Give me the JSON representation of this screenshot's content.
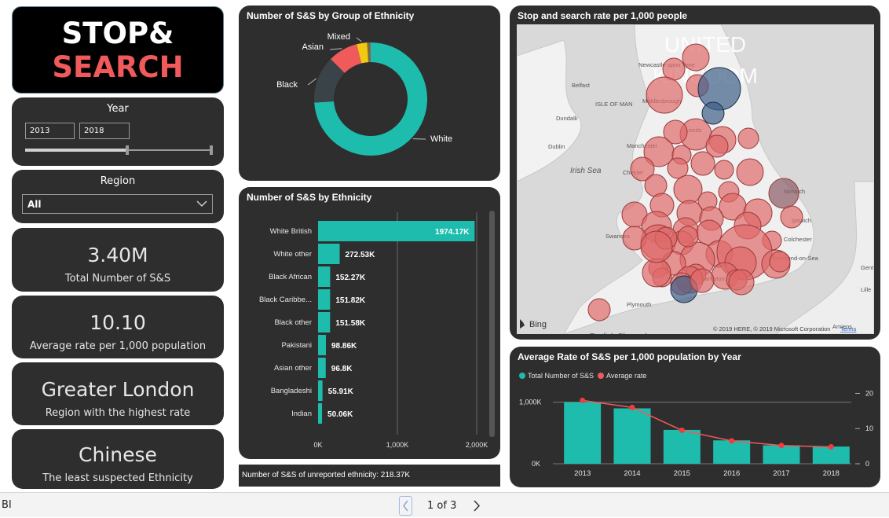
{
  "logo": {
    "line1": "STOP&",
    "line2": "SEARCH"
  },
  "year_slicer": {
    "title": "Year",
    "from": "2013",
    "to": "2018"
  },
  "region_slicer": {
    "title": "Region",
    "selected": "All"
  },
  "kpis": [
    {
      "value": "3.40M",
      "label": "Total Number of S&S"
    },
    {
      "value": "10.10",
      "label": "Average rate per 1,000 population"
    },
    {
      "value": "Greater London",
      "label": "Region with the highest rate"
    },
    {
      "value": "Chinese",
      "label": "The least suspected Ethnicity"
    }
  ],
  "donut": {
    "title": "Number of S&S by Group of Ethnicity",
    "chart_data": {
      "type": "pie",
      "categories": [
        "White",
        "Black",
        "Asian",
        "Mixed",
        "Other"
      ],
      "values": [
        74,
        13.5,
        8.5,
        3,
        1
      ],
      "colors": [
        "#1ebcad",
        "#3a4448",
        "#f05a5a",
        "#f2c811",
        "#7a6a4a"
      ],
      "labels": [
        "White",
        "Black",
        "Asian",
        "Mixed"
      ]
    }
  },
  "bars": {
    "title": "Number of S&S by Ethnicity",
    "chart_data": {
      "type": "bar",
      "orientation": "horizontal",
      "categories": [
        "White British",
        "White other",
        "Black African",
        "Black Caribbe...",
        "Black other",
        "Pakistani",
        "Asian other",
        "Bangladeshi",
        "Indian"
      ],
      "values": [
        1974170,
        272530,
        152270,
        151820,
        151580,
        98860,
        96800,
        55910,
        50060
      ],
      "data_labels": [
        "1974.17K",
        "272.53K",
        "152.27K",
        "151.82K",
        "151.58K",
        "98.86K",
        "96.8K",
        "55.91K",
        "50.06K"
      ],
      "x_ticks": [
        "0K",
        "1,000K",
        "2,000K"
      ],
      "xlim": [
        0,
        2000000
      ],
      "color": "#1ebcad"
    },
    "footer_label": "Number of S&S of unreported ethnicity:",
    "footer_value": "218.37K"
  },
  "map": {
    "title": "Stop and search rate per 1,000 people",
    "place_labels": [
      "Newcastle upon Tyne",
      "Belfast",
      "ISLE OF MAN",
      "Dundalk",
      "Middlesbrough",
      "Leeds",
      "Dublin",
      "Irish Sea",
      "Manchester",
      "Chester",
      "Norwich",
      "Ipswich",
      "Swansea",
      "Cardiff",
      "Colchester",
      "Southend-on-Sea",
      "Plymouth",
      "Poole",
      "Southampton",
      "Gent",
      "Lille",
      "Amiens",
      "English Channel"
    ],
    "watermark": [
      "UNITED",
      "KINGDOM"
    ],
    "bing": "Bing",
    "copyright": "© 2019 HERE, © 2019 Microsoft Corporation",
    "terms": "Terms"
  },
  "combo": {
    "title": "Average Rate of S&S per 1,000 population by Year",
    "legend": [
      "Total Number of S&S",
      "Average rate"
    ],
    "chart_data": {
      "type": "bar",
      "categories": [
        "2013",
        "2014",
        "2015",
        "2016",
        "2017",
        "2018"
      ],
      "series": [
        {
          "name": "Total Number of S&S",
          "type": "bar",
          "values": [
            1000000,
            900000,
            550000,
            380000,
            300000,
            280000
          ],
          "color": "#1ebcad"
        },
        {
          "name": "Average rate",
          "type": "line",
          "values": [
            18,
            16,
            9.5,
            6.5,
            5.2,
            4.8
          ],
          "color": "#f05a5a"
        }
      ],
      "y_ticks": [
        "0K",
        "1,000K"
      ],
      "y2_ticks": [
        "0",
        "10",
        "20"
      ],
      "ylim": [
        0,
        1200000
      ],
      "y2lim": [
        0,
        21
      ]
    }
  },
  "pager": {
    "label": "1 of 3",
    "app": "BI"
  }
}
